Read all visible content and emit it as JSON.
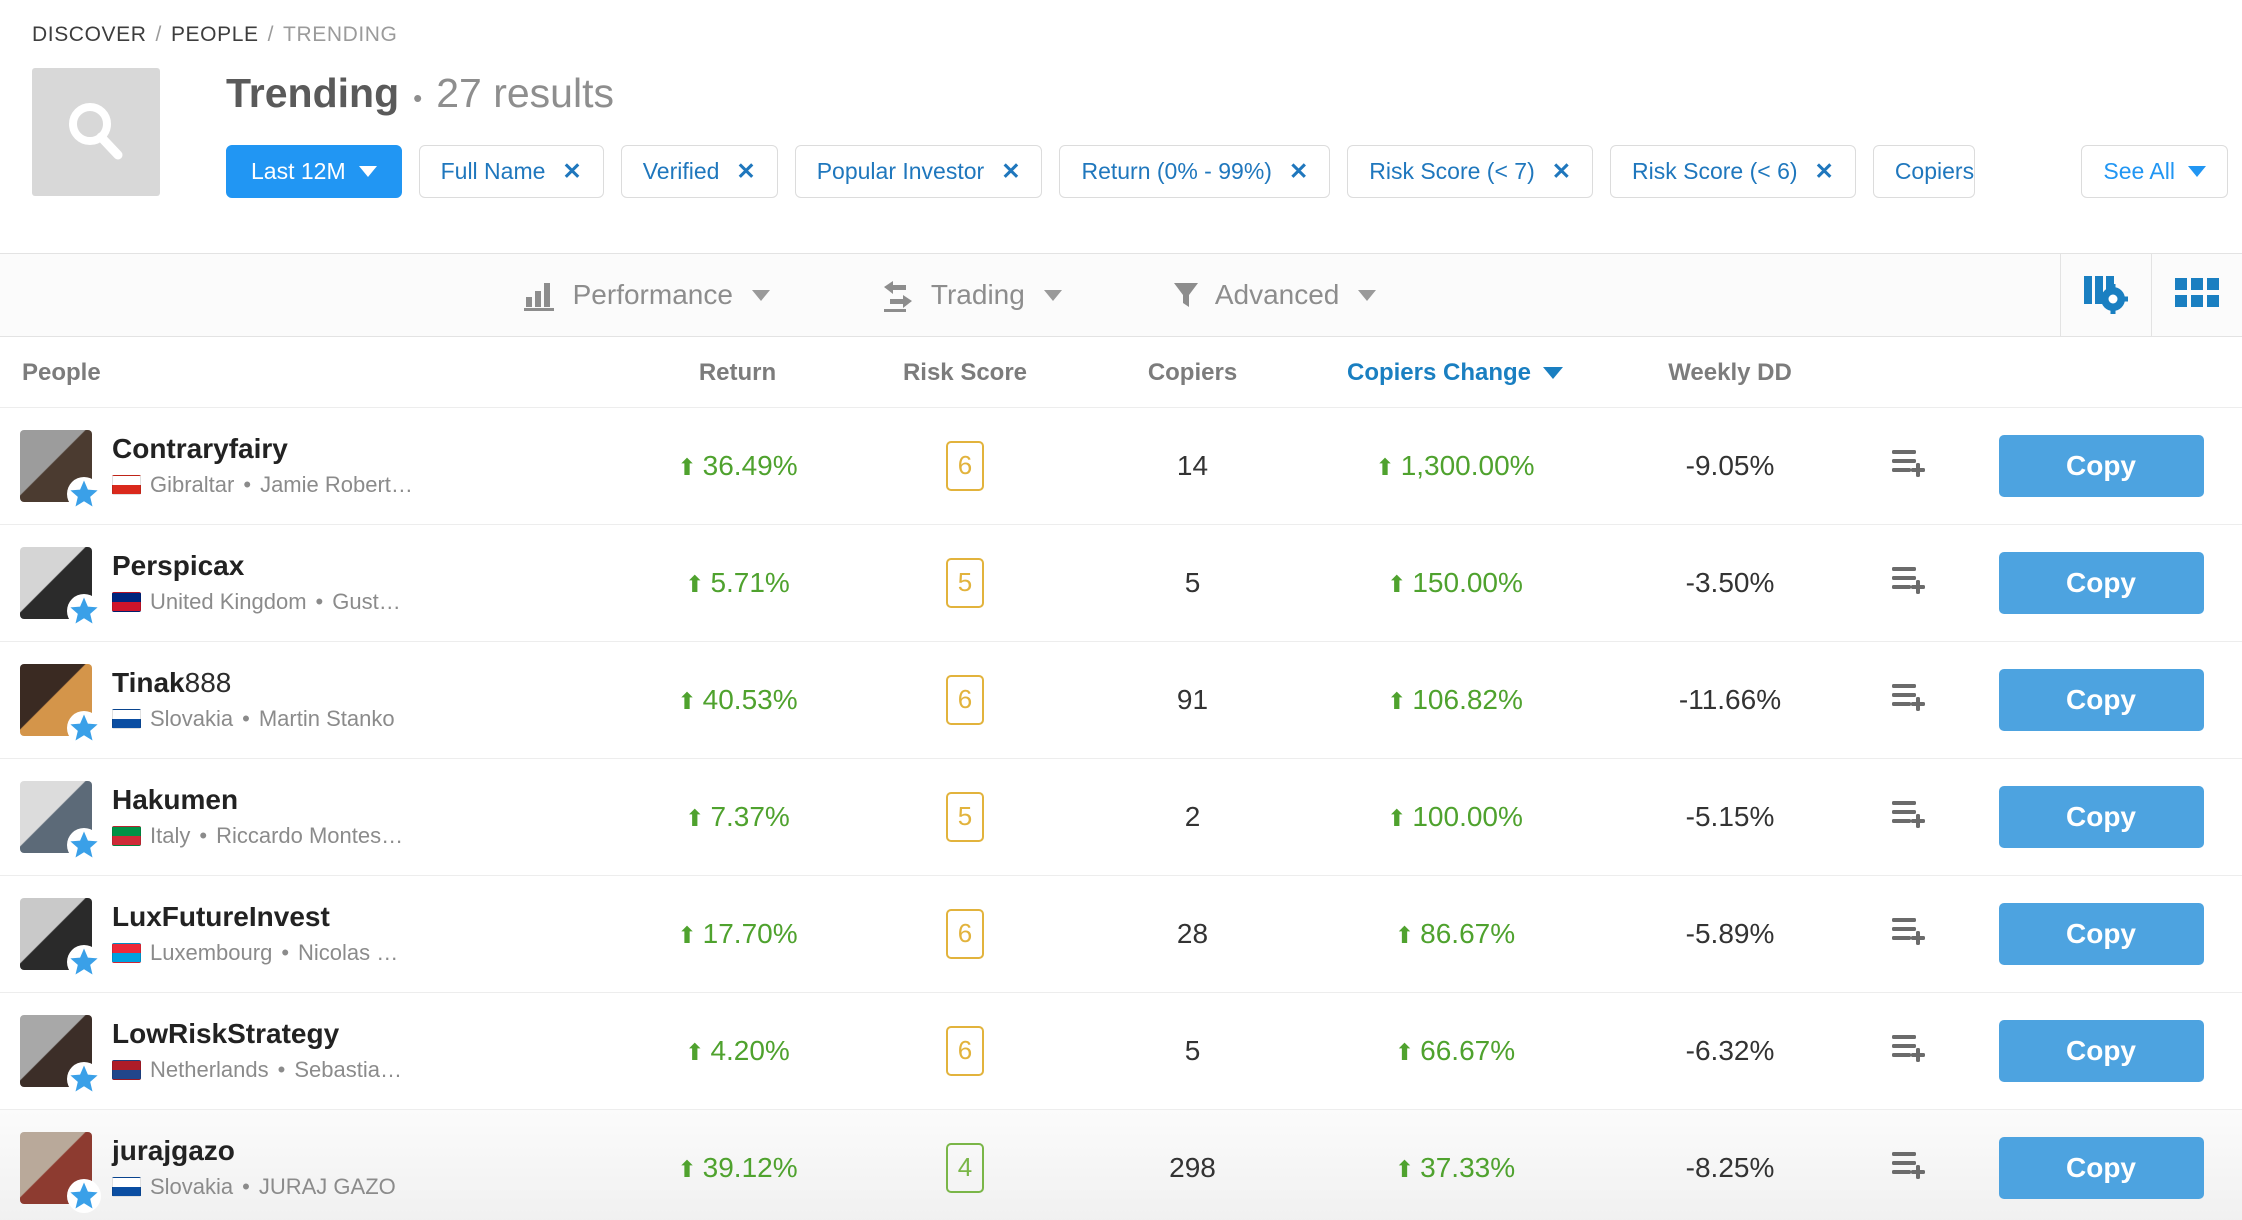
{
  "breadcrumb": {
    "items": [
      "DISCOVER",
      "PEOPLE",
      "TRENDING"
    ],
    "separator": "/"
  },
  "header": {
    "search_icon": "search-icon",
    "title": "Trending",
    "bullet": "•",
    "results": "27 results"
  },
  "filters": {
    "period": {
      "label": "Last 12M",
      "caret": "chevron-down-icon"
    },
    "chips": [
      {
        "label": "Full Name",
        "remove": "✕"
      },
      {
        "label": "Verified",
        "remove": "✕"
      },
      {
        "label": "Popular Investor",
        "remove": "✕"
      },
      {
        "label": "Return (0% - 99%)",
        "remove": "✕"
      },
      {
        "label": "Risk Score (< 7)",
        "remove": "✕"
      },
      {
        "label": "Risk Score (< 6)",
        "remove": "✕"
      },
      {
        "label": "Copiers",
        "remove": "✕"
      }
    ],
    "see_all": {
      "label": "See All",
      "caret": "chevron-down-icon"
    }
  },
  "toolbar": {
    "menus": [
      {
        "label": "Performance",
        "icon": "bar-chart-icon"
      },
      {
        "label": "Trading",
        "icon": "exchange-arrows-icon"
      },
      {
        "label": "Advanced",
        "icon": "funnel-filter-icon"
      }
    ],
    "icons": [
      {
        "name": "columns-settings-icon"
      },
      {
        "name": "grid-view-icon"
      }
    ]
  },
  "table": {
    "columns": [
      {
        "key": "people",
        "label": "People",
        "sorted": false
      },
      {
        "key": "return",
        "label": "Return",
        "sorted": false
      },
      {
        "key": "risk",
        "label": "Risk Score",
        "sorted": false
      },
      {
        "key": "copiers",
        "label": "Copiers",
        "sorted": false
      },
      {
        "key": "copiers_change",
        "label": "Copiers Change",
        "sorted": true
      },
      {
        "key": "weekly_dd",
        "label": "Weekly DD",
        "sorted": false
      }
    ],
    "row_action_icon": "add-to-list-icon",
    "copy_label": "Copy",
    "rows": [
      {
        "name": "Contraryfairy",
        "name_suffix": "",
        "country": "Gibraltar",
        "real_name": "Jamie Robert…",
        "flag_colors": [
          "#ffffff",
          "#da291c"
        ],
        "avatar_colors": [
          "#9c9c9c",
          "#4b3b30"
        ],
        "verified": true,
        "return": "36.49%",
        "return_dir": "up",
        "risk": "6",
        "risk_color": "amber",
        "copiers": "14",
        "copiers_change": "1,300.00%",
        "copiers_change_dir": "up",
        "weekly_dd": "-9.05%"
      },
      {
        "name": "Perspicax",
        "name_suffix": "",
        "country": "United Kingdom",
        "real_name": "Gust…",
        "flag_colors": [
          "#00247d",
          "#cf142b"
        ],
        "avatar_colors": [
          "#d5d5d5",
          "#2b2b2b"
        ],
        "verified": true,
        "return": "5.71%",
        "return_dir": "up",
        "risk": "5",
        "risk_color": "amber",
        "copiers": "5",
        "copiers_change": "150.00%",
        "copiers_change_dir": "up",
        "weekly_dd": "-3.50%"
      },
      {
        "name": "Tinak",
        "name_suffix": "888",
        "country": "Slovakia",
        "real_name": "Martin Stanko",
        "flag_colors": [
          "#ffffff",
          "#0b4ea2"
        ],
        "avatar_colors": [
          "#3a2a22",
          "#d4954a"
        ],
        "verified": true,
        "return": "40.53%",
        "return_dir": "up",
        "risk": "6",
        "risk_color": "amber",
        "copiers": "91",
        "copiers_change": "106.82%",
        "copiers_change_dir": "up",
        "weekly_dd": "-11.66%"
      },
      {
        "name": "Hakumen",
        "name_suffix": "",
        "country": "Italy",
        "real_name": "Riccardo Montes…",
        "flag_colors": [
          "#009246",
          "#ce2b37"
        ],
        "avatar_colors": [
          "#dcdcdc",
          "#5c6a78"
        ],
        "verified": true,
        "return": "7.37%",
        "return_dir": "up",
        "risk": "5",
        "risk_color": "amber",
        "copiers": "2",
        "copiers_change": "100.00%",
        "copiers_change_dir": "up",
        "weekly_dd": "-5.15%"
      },
      {
        "name": "LuxFutureInvest",
        "name_suffix": "",
        "country": "Luxembourg",
        "real_name": "Nicolas …",
        "flag_colors": [
          "#ed2939",
          "#00a1de"
        ],
        "avatar_colors": [
          "#c9c9c9",
          "#2a2a2a"
        ],
        "verified": true,
        "return": "17.70%",
        "return_dir": "up",
        "risk": "6",
        "risk_color": "amber",
        "copiers": "28",
        "copiers_change": "86.67%",
        "copiers_change_dir": "up",
        "weekly_dd": "-5.89%"
      },
      {
        "name": "LowRiskStrategy",
        "name_suffix": "",
        "country": "Netherlands",
        "real_name": "Sebastia…",
        "flag_colors": [
          "#ae1c28",
          "#21468b"
        ],
        "avatar_colors": [
          "#a8a8a8",
          "#3c2e28"
        ],
        "verified": true,
        "return": "4.20%",
        "return_dir": "up",
        "risk": "6",
        "risk_color": "amber",
        "copiers": "5",
        "copiers_change": "66.67%",
        "copiers_change_dir": "up",
        "weekly_dd": "-6.32%"
      },
      {
        "name": "jurajgazo",
        "name_suffix": "",
        "country": "Slovakia",
        "real_name": "JURAJ GAZO",
        "flag_colors": [
          "#ffffff",
          "#0b4ea2"
        ],
        "avatar_colors": [
          "#b9a99a",
          "#8d3b30"
        ],
        "verified": true,
        "return": "39.12%",
        "return_dir": "up",
        "risk": "4",
        "risk_color": "green",
        "copiers": "298",
        "copiers_change": "37.33%",
        "copiers_change_dir": "up",
        "weekly_dd": "-8.25%"
      }
    ]
  },
  "colors": {
    "accent_blue": "#2196f3",
    "link_blue": "#1f77bd",
    "positive_green": "#4fa22e",
    "risk_amber": "#e2b33c",
    "risk_green": "#7ab648",
    "copy_button": "#4da3e0"
  }
}
